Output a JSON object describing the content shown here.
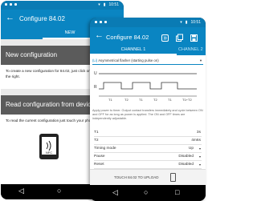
{
  "back_screen": {
    "status": {
      "signal": "▾",
      "battery": "▮",
      "time": "10:51"
    },
    "toolbar": {
      "back": "←",
      "title": "Configure 84.02"
    },
    "tab_new": "NEW",
    "new_config": {
      "heading": "New configuration",
      "body": "To create a new configuration for 84.02, just click on the button on the right."
    },
    "read_config": {
      "heading": "Read configuration from device",
      "body": "To read the current configuration just touch your phone to the 84.02."
    },
    "nfc_label": "NFC",
    "nav": {
      "back": "◁",
      "home": "○",
      "recent": "□"
    }
  },
  "front_screen": {
    "status": {
      "signal": "▾",
      "battery": "▮",
      "time": "10:51"
    },
    "toolbar": {
      "back": "←",
      "title": "Configure 84.02",
      "icons": [
        "nfc-icon",
        "copy-icon",
        "save-icon"
      ]
    },
    "tabs": {
      "channel1": "CHANNEL 1",
      "channel2": "CHANNEL 2"
    },
    "mode": {
      "code": "(Li)",
      "label": "Asymmetrical flasher (starting pulse on)",
      "arrow": "▾"
    },
    "timing_diagram": {
      "label_u": "U",
      "label_r": "R",
      "t_labels": [
        "T1",
        "T2",
        "T1",
        "T2",
        "T1",
        "T1+T2"
      ]
    },
    "description": "Apply power to timer. Output contact transfers immediately and cycle between ON and OFF for as long as power is applied. The ON and OFF times are independently adjustable.",
    "params": [
      {
        "label": "T1",
        "value": "3s",
        "caret": ""
      },
      {
        "label": "T2",
        "value": "4m6s",
        "caret": ""
      },
      {
        "label": "Timing mode",
        "value": "Up",
        "caret": "▾"
      },
      {
        "label": "Pause",
        "value": "Disabled",
        "caret": "▾"
      },
      {
        "label": "Reset",
        "value": "Disabled",
        "caret": "▾"
      }
    ],
    "upload_label": "TOUCH 84.02 TO UPLOAD",
    "nav": {
      "back": "◁",
      "home": "○",
      "recent": "□"
    }
  },
  "colors": {
    "primary": "#0a85c2",
    "status_bar": "#0a7bb4",
    "card_header": "#5b5b5b"
  }
}
